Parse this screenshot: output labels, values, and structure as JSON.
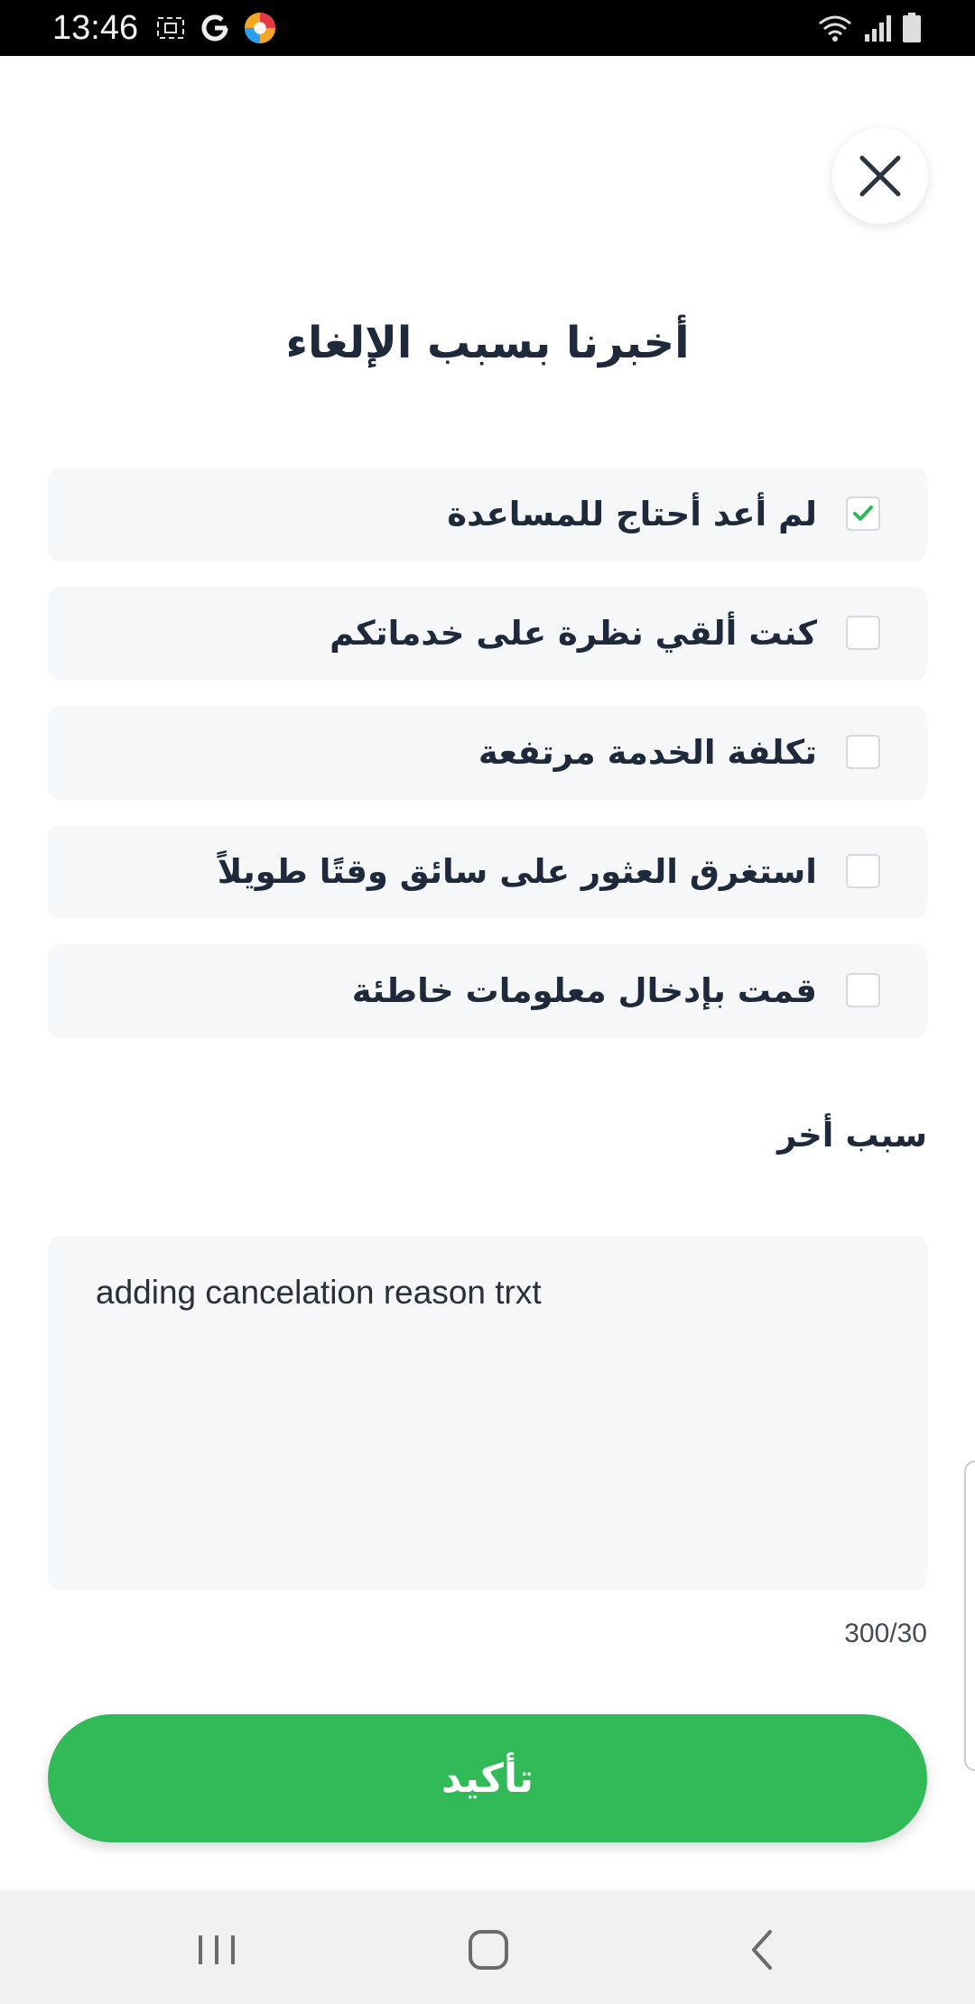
{
  "status_bar": {
    "time": "13:46",
    "icons": [
      "screenshot-icon",
      "google-icon",
      "browser-icon",
      "wifi-icon",
      "signal-icon",
      "battery-icon"
    ]
  },
  "dialog": {
    "title": "أخبرنا بسبب الإلغاء",
    "options": [
      {
        "label": "لم أعد أحتاج للمساعدة",
        "checked": true
      },
      {
        "label": "كنت ألقي نظرة على خدماتكم",
        "checked": false
      },
      {
        "label": "تكلفة الخدمة مرتفعة",
        "checked": false
      },
      {
        "label": "استغرق العثور على سائق وقتًا طويلاً",
        "checked": false
      },
      {
        "label": "قمت بإدخال معلومات خاطئة",
        "checked": false
      }
    ],
    "other_reason": {
      "label": "سبب أخر",
      "value": "adding cancelation reason trxt",
      "char_count": "300/30"
    },
    "confirm_label": "تأكيد"
  },
  "colors": {
    "accent": "#32ba58",
    "text": "#1e2a3b",
    "option_bg": "#f6f7f9"
  }
}
